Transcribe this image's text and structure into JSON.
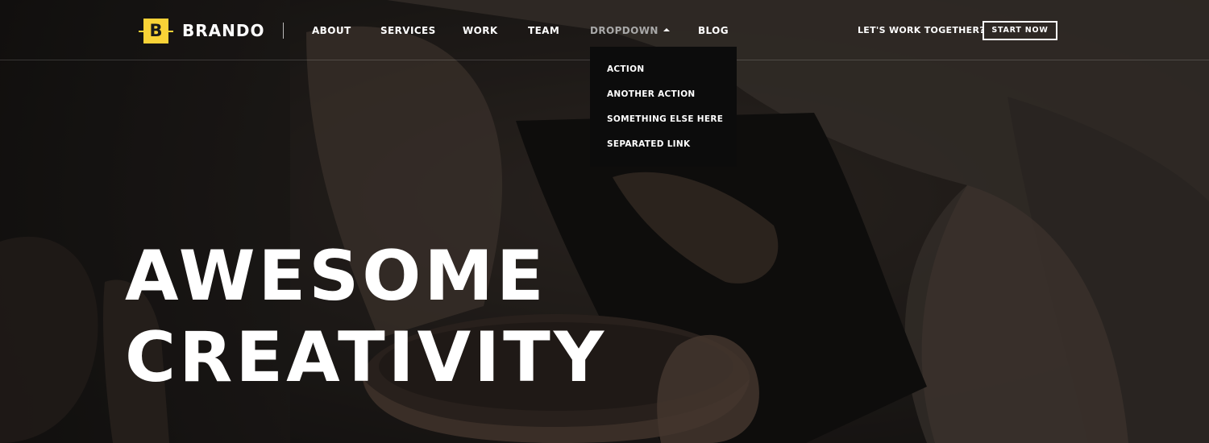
{
  "brand": {
    "logo_letter": "B",
    "name": "BRANDO",
    "accent_color": "#f9d237"
  },
  "nav": {
    "items": [
      {
        "label": "ABOUT"
      },
      {
        "label": "SERVICES"
      },
      {
        "label": "WORK"
      },
      {
        "label": "TEAM"
      },
      {
        "label": "DROPDOWN",
        "active": true
      },
      {
        "label": "BLOG"
      }
    ],
    "dropdown_items": [
      {
        "label": "ACTION"
      },
      {
        "label": "ANOTHER ACTION"
      },
      {
        "label": "SOMETHING ELSE HERE"
      },
      {
        "label": "SEPARATED LINK"
      }
    ]
  },
  "cta": {
    "text": "LET'S WORK TOGETHER?",
    "button_label": "START NOW"
  },
  "hero": {
    "line1": "AWESOME",
    "line2": "CREATIVITY",
    "background": "photo-pottery-hands"
  }
}
